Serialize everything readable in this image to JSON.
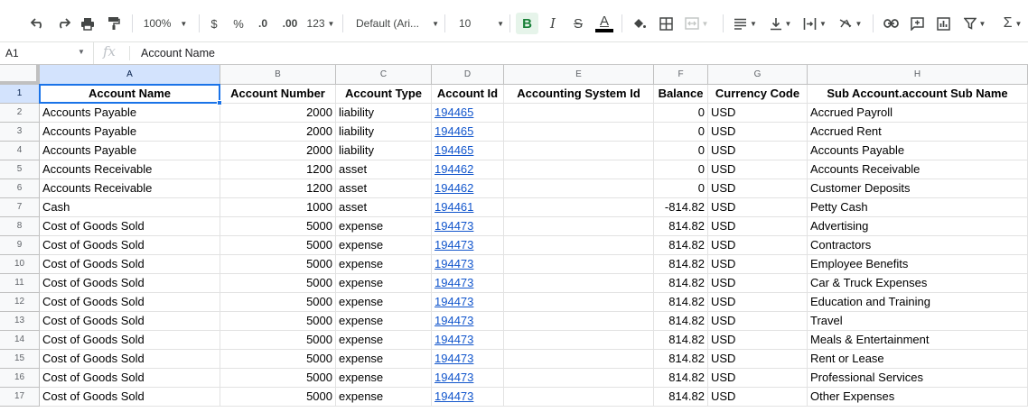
{
  "toolbar": {
    "zoom": "100%",
    "currency": "$",
    "percent": "%",
    "decrease_decimal": ".0",
    "increase_decimal": ".00",
    "more_formats": "123",
    "font": "Default (Ari...",
    "font_size": "10",
    "bold": "B",
    "italic": "I",
    "strike": "S",
    "text_color": "A",
    "sum": "Σ"
  },
  "formula_bar": {
    "cell_ref": "A1",
    "fx": "fx",
    "content": "Account Name"
  },
  "columns": [
    "A",
    "B",
    "C",
    "D",
    "E",
    "F",
    "G",
    "H"
  ],
  "rows": [
    {
      "num": "1",
      "cells": [
        "Account Name",
        "Account Number",
        "Account Type",
        "Account Id",
        "Accounting System Id",
        "Balance",
        "Currency Code",
        "Sub Account.account Sub Name"
      ]
    },
    {
      "num": "2",
      "cells": [
        "Accounts Payable",
        "2000",
        "liability",
        "194465",
        "",
        "0",
        "USD",
        "Accrued Payroll"
      ]
    },
    {
      "num": "3",
      "cells": [
        "Accounts Payable",
        "2000",
        "liability",
        "194465",
        "",
        "0",
        "USD",
        "Accrued Rent"
      ]
    },
    {
      "num": "4",
      "cells": [
        "Accounts Payable",
        "2000",
        "liability",
        "194465",
        "",
        "0",
        "USD",
        "Accounts Payable"
      ]
    },
    {
      "num": "5",
      "cells": [
        "Accounts Receivable",
        "1200",
        "asset",
        "194462",
        "",
        "0",
        "USD",
        "Accounts Receivable"
      ]
    },
    {
      "num": "6",
      "cells": [
        "Accounts Receivable",
        "1200",
        "asset",
        "194462",
        "",
        "0",
        "USD",
        "Customer Deposits"
      ]
    },
    {
      "num": "7",
      "cells": [
        "Cash",
        "1000",
        "asset",
        "194461",
        "",
        "-814.82",
        "USD",
        "Petty Cash"
      ]
    },
    {
      "num": "8",
      "cells": [
        "Cost of Goods Sold",
        "5000",
        "expense",
        "194473",
        "",
        "814.82",
        "USD",
        "Advertising"
      ]
    },
    {
      "num": "9",
      "cells": [
        "Cost of Goods Sold",
        "5000",
        "expense",
        "194473",
        "",
        "814.82",
        "USD",
        "Contractors"
      ]
    },
    {
      "num": "10",
      "cells": [
        "Cost of Goods Sold",
        "5000",
        "expense",
        "194473",
        "",
        "814.82",
        "USD",
        "Employee Benefits"
      ]
    },
    {
      "num": "11",
      "cells": [
        "Cost of Goods Sold",
        "5000",
        "expense",
        "194473",
        "",
        "814.82",
        "USD",
        "Car & Truck Expenses"
      ]
    },
    {
      "num": "12",
      "cells": [
        "Cost of Goods Sold",
        "5000",
        "expense",
        "194473",
        "",
        "814.82",
        "USD",
        "Education and Training"
      ]
    },
    {
      "num": "13",
      "cells": [
        "Cost of Goods Sold",
        "5000",
        "expense",
        "194473",
        "",
        "814.82",
        "USD",
        "Travel"
      ]
    },
    {
      "num": "14",
      "cells": [
        "Cost of Goods Sold",
        "5000",
        "expense",
        "194473",
        "",
        "814.82",
        "USD",
        "Meals & Entertainment"
      ]
    },
    {
      "num": "15",
      "cells": [
        "Cost of Goods Sold",
        "5000",
        "expense",
        "194473",
        "",
        "814.82",
        "USD",
        "Rent or Lease"
      ]
    },
    {
      "num": "16",
      "cells": [
        "Cost of Goods Sold",
        "5000",
        "expense",
        "194473",
        "",
        "814.82",
        "USD",
        "Professional Services"
      ]
    },
    {
      "num": "17",
      "cells": [
        "Cost of Goods Sold",
        "5000",
        "expense",
        "194473",
        "",
        "814.82",
        "USD",
        "Other Expenses"
      ]
    }
  ],
  "colors": {
    "selection": "#1a73e8",
    "link": "#1155cc",
    "bold_active_bg": "#e6f4ea",
    "text_color_bar": "#000000"
  }
}
